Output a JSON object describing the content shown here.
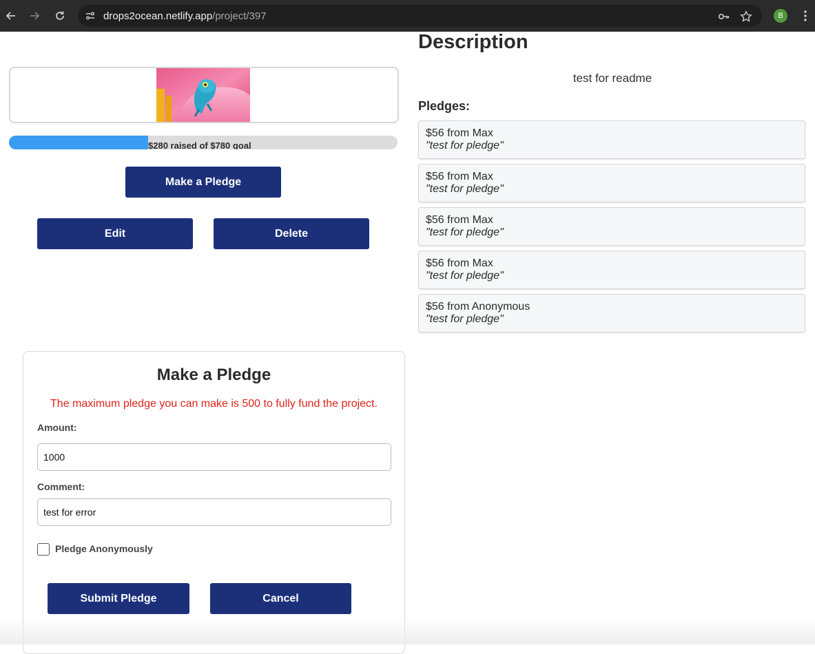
{
  "browser": {
    "url_host": "drops2ocean.netlify.app",
    "url_path": "/project/397",
    "profile_initial": "B",
    "icons": [
      "back-arrow-icon",
      "forward-arrow-icon",
      "reload-icon",
      "site-settings-icon",
      "key-icon",
      "star-icon",
      "kebab-menu-icon"
    ]
  },
  "project": {
    "image_subject": "chameleon on pink flower",
    "progress_label": "$280 raised of $780 goal",
    "progress_fraction": 0.359,
    "make_pledge_label": "Make a Pledge",
    "edit_label": "Edit",
    "delete_label": "Delete"
  },
  "description": {
    "heading": "Description",
    "text": "test for readme"
  },
  "pledges": {
    "heading": "Pledges:",
    "items": [
      {
        "line": "$56 from Max",
        "comment": "\"test for pledge\""
      },
      {
        "line": "$56 from Max",
        "comment": "\"test for pledge\""
      },
      {
        "line": "$56 from Max",
        "comment": "\"test for pledge\""
      },
      {
        "line": "$56 from Max",
        "comment": "\"test for pledge\""
      },
      {
        "line": "$56 from Anonymous",
        "comment": "\"test for pledge\""
      }
    ]
  },
  "pledge_form": {
    "title": "Make a Pledge",
    "error": "The maximum pledge you can make is 500 to fully fund the project.",
    "amount_label": "Amount:",
    "amount_value": "1000",
    "comment_label": "Comment:",
    "comment_value": "test for error",
    "anonymous_label": "Pledge Anonymously",
    "anonymous_checked": false,
    "submit_label": "Submit Pledge",
    "cancel_label": "Cancel"
  },
  "colors": {
    "accent_button": "#1c307a",
    "progress_fill": "#3a9cf0",
    "error_text": "#e0231a"
  }
}
